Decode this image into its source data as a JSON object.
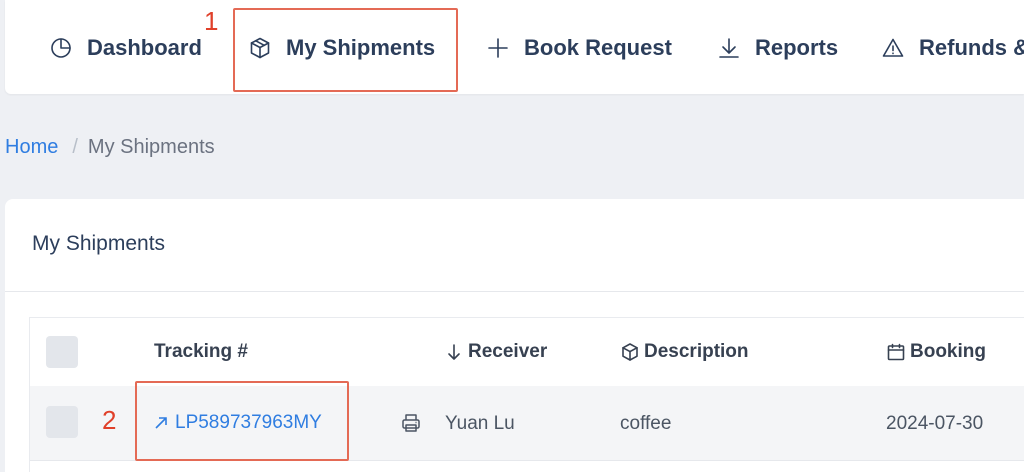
{
  "nav": {
    "items": [
      {
        "label": "Dashboard",
        "icon": "pie-chart-icon"
      },
      {
        "label": "My Shipments",
        "icon": "box-icon"
      },
      {
        "label": "Book Request",
        "icon": "plus-icon"
      },
      {
        "label": "Reports",
        "icon": "download-icon"
      },
      {
        "label": "Refunds &",
        "icon": "warning-icon"
      }
    ]
  },
  "annotations": {
    "one": "1",
    "two": "2",
    "color": "#e46a55"
  },
  "breadcrumb": {
    "home": "Home",
    "separator": "/",
    "current": "My Shipments"
  },
  "card": {
    "title": "My Shipments"
  },
  "table": {
    "headers": {
      "tracking": "Tracking #",
      "receiver": "Receiver",
      "description": "Description",
      "booking": "Booking"
    },
    "rows": [
      {
        "tracking": "LP589737963MY",
        "receiver": "Yuan Lu",
        "description": "coffee",
        "booking": "2024-07-30"
      }
    ]
  },
  "colors": {
    "accent": "#2f7de1",
    "nav_text": "#2c3e5b",
    "background": "#eef0f4"
  }
}
